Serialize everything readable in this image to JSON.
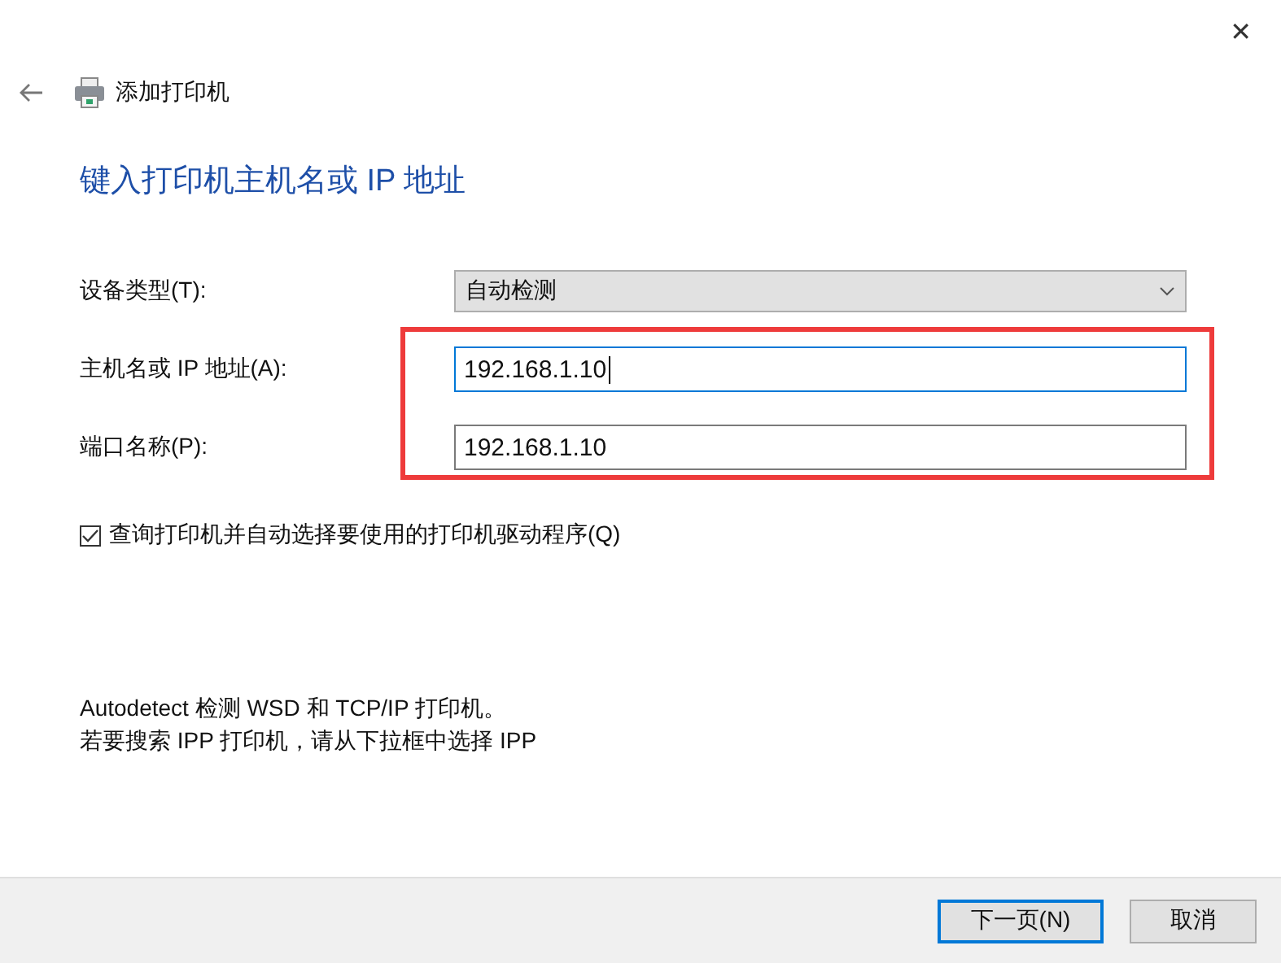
{
  "window": {
    "title": "添加打印机",
    "close": "✕"
  },
  "heading": "键入打印机主机名或 IP 地址",
  "fields": [
    {
      "kind": "dropdown",
      "label": "设备类型(T):",
      "value": "自动检测",
      "focused": false
    },
    {
      "kind": "text",
      "label": "主机名或 IP 地址(A):",
      "value": "192.168.1.10",
      "focused": true
    },
    {
      "kind": "text",
      "label": "端口名称(P):",
      "value": "192.168.1.10",
      "focused": false
    }
  ],
  "annotation": {
    "kind": "rectangle"
  },
  "query_checkbox": {
    "label": "查询打印机并自动选择要使用的打印机驱动程序(Q)",
    "checked": true
  },
  "info": [
    "Autodetect 检测 WSD 和 TCP/IP 打印机。",
    "若要搜索 IPP 打印机，请从下拉框中选择 IPP"
  ],
  "buttons": [
    {
      "label": "下一页(N)",
      "default": true
    },
    {
      "label": "取消",
      "default": false
    }
  ]
}
